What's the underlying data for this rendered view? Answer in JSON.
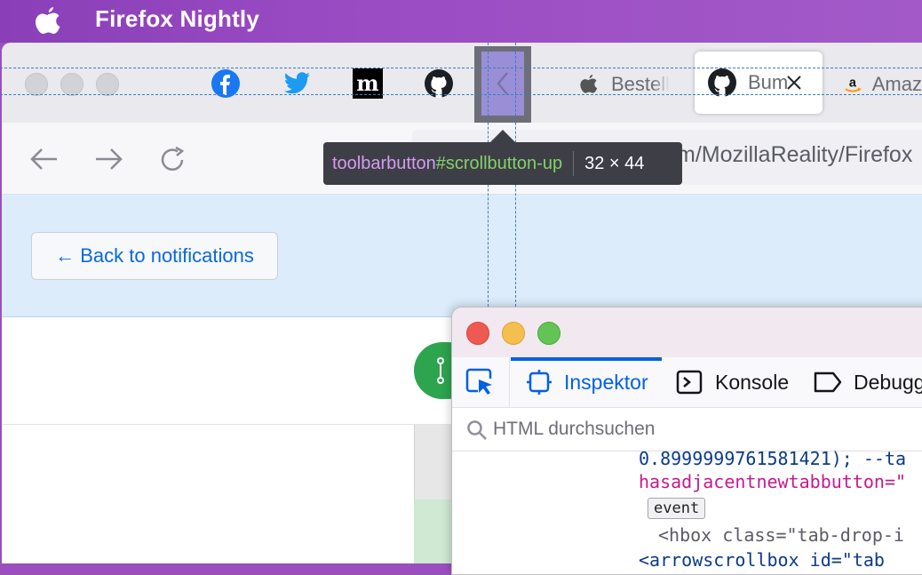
{
  "menubar": {
    "app_name": "Firefox Nightly",
    "apple_icon": "apple-logo-icon"
  },
  "tabs": {
    "pinned": [
      "facebook-icon",
      "twitter-icon",
      "medium-icon",
      "github-icon"
    ],
    "scroll_button_icon": "chevron-left-icon",
    "items": [
      {
        "label": "Bestell",
        "icon": "apple-logo-icon"
      },
      {
        "label": "Bum",
        "icon": "github-icon",
        "selected": true
      },
      {
        "label": "Amaz",
        "icon": "amazon-icon"
      }
    ]
  },
  "nav": {
    "url": "m/MozillaReality/Firefox"
  },
  "tooltip": {
    "selector_tag": "toolbarbutton",
    "selector_id": "#scrollbutton-up",
    "dimensions": "32 × 44"
  },
  "page": {
    "back_button": "← Back to notifications"
  },
  "devtools": {
    "tabs": {
      "inspector": "Inspektor",
      "console": "Konsole",
      "debugger": "Debugg"
    },
    "search_placeholder": "HTML durchsuchen",
    "code": {
      "line1": "0.8999999761581421); --ta",
      "line2_attr": "hasadjacentnewtabbutton=\"",
      "line3_badge": "event",
      "line4": "<hbox class=\"tab-drop-i",
      "line5": "<arrowscrollbox id=\"tab"
    }
  },
  "colors": {
    "accent": "#0061e0",
    "tooltip_tag": "#d69cf0",
    "tooltip_id": "#82d269",
    "code_attr": "#c41b8c",
    "code_value": "#0a3a8a"
  }
}
